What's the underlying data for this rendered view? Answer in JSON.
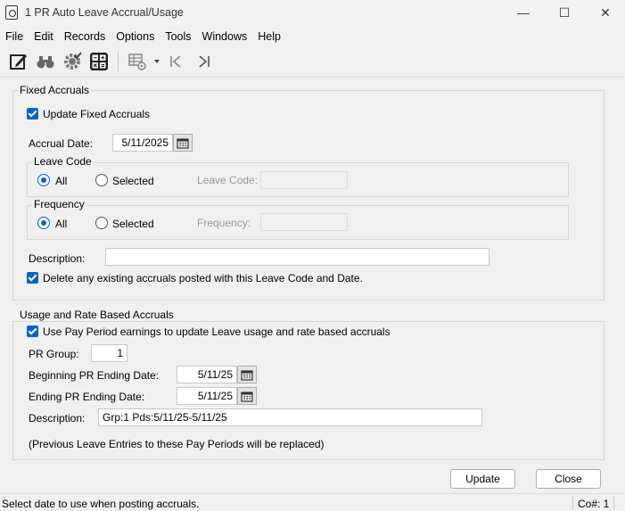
{
  "window": {
    "title": "1 PR Auto Leave Accrual/Usage",
    "minimize": "—",
    "maximize": "☐",
    "close": "✕"
  },
  "menu": [
    "File",
    "Edit",
    "Records",
    "Options",
    "Tools",
    "Windows",
    "Help"
  ],
  "toolbar": {
    "icons": [
      "edit-icon",
      "binoculars-icon",
      "settings-check-icon",
      "calculator-icon",
      "grid-settings-icon",
      "dropdown-arrow-icon",
      "first-record-icon",
      "last-record-icon"
    ]
  },
  "fixed": {
    "legend": "Fixed Accruals",
    "update_label": "Update Fixed Accruals",
    "update_checked": true,
    "accrual_date_label": "Accrual Date:",
    "accrual_date": "5/11/2025",
    "leave_code": {
      "legend": "Leave Code",
      "all": "All",
      "selected": "Selected",
      "field_label": "Leave Code:",
      "field_value": "",
      "choice": "All"
    },
    "frequency": {
      "legend": "Frequency",
      "all": "All",
      "selected": "Selected",
      "field_label": "Frequency:",
      "field_value": "",
      "choice": "All"
    },
    "description_label": "Description:",
    "description": "",
    "delete_label": "Delete any existing accruals posted with this Leave Code and Date.",
    "delete_checked": true
  },
  "usage": {
    "legend": "Usage and Rate Based Accruals",
    "use_label": "Use Pay Period earnings to update Leave usage and rate based accruals",
    "use_checked": true,
    "pr_group_label": "PR Group:",
    "pr_group": "1",
    "begin_label": "Beginning PR Ending Date:",
    "begin_date": "5/11/25",
    "end_label": "Ending PR Ending Date:",
    "end_date": "5/11/25",
    "description_label": "Description:",
    "description": "Grp:1  Pds:5/11/25-5/11/25",
    "note": "(Previous Leave Entries to these Pay Periods will be replaced)"
  },
  "buttons": {
    "update": "Update",
    "close": "Close"
  },
  "status": {
    "message": "Select date to use when posting accruals.",
    "company": "Co#: 1"
  },
  "colors": {
    "accent": "#0a64c8",
    "background": "#f0f0f0"
  }
}
